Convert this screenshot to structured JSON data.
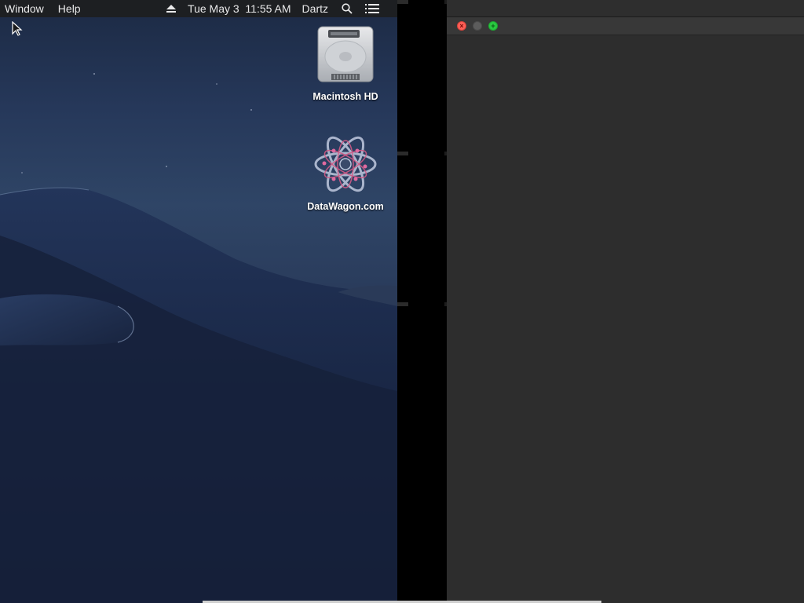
{
  "menubar": {
    "items": [
      {
        "label": "Window"
      },
      {
        "label": "Help"
      }
    ],
    "status": {
      "eject_icon": "eject-icon",
      "datetime": "Tue May 3  11:55 AM",
      "user": "Dartz",
      "search_icon": "search-icon",
      "list_icon": "notification-center-icon"
    }
  },
  "desktop": {
    "icons": [
      {
        "label": "Macintosh HD",
        "icon": "hard-drive-icon"
      },
      {
        "label": "DataWagon.com",
        "icon": "datawagon-logo-icon"
      }
    ]
  },
  "window": {
    "buttons": {
      "close": {
        "glyph": "×",
        "color": "#ff5f57"
      },
      "minimize": {
        "glyph": "",
        "color": "#5c5c5c"
      },
      "zoom": {
        "glyph": "+",
        "color": "#29c940"
      }
    }
  }
}
